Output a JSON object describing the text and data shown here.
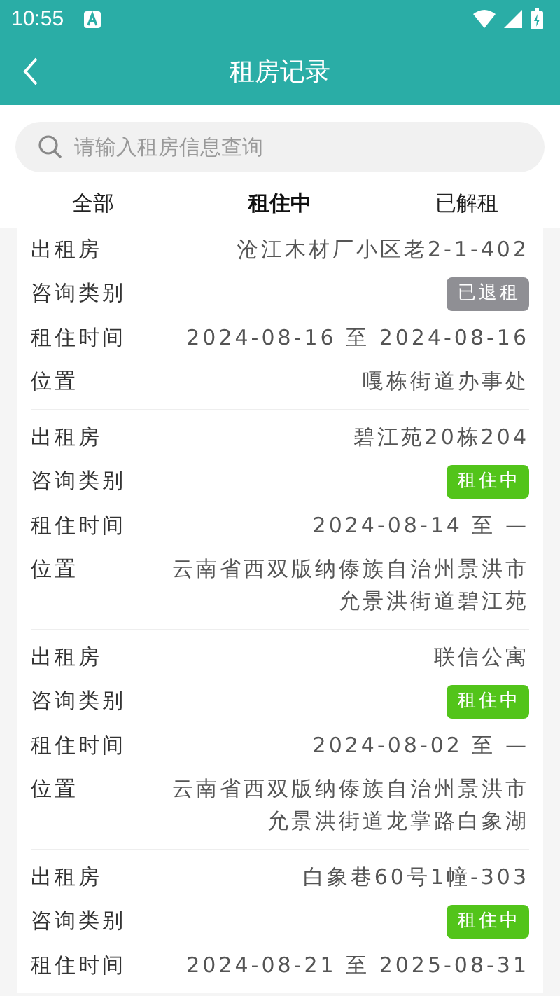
{
  "status_bar": {
    "time": "10:55"
  },
  "header": {
    "title": "租房记录"
  },
  "search": {
    "placeholder": "请输入租房信息查询"
  },
  "tabs": [
    {
      "label": "全部",
      "selected": false
    },
    {
      "label": "租住中",
      "selected": true
    },
    {
      "label": "已解租",
      "selected": false
    }
  ],
  "records": [
    {
      "rows": [
        {
          "kind": "text",
          "label": "出租房",
          "value": "沧江木材厂小区老2-1-402"
        },
        {
          "kind": "badge",
          "label": "咨询类别",
          "badge": {
            "label": "已退租",
            "kind": "ended"
          }
        },
        {
          "kind": "text",
          "label": "租住时间",
          "value": "2024-08-16 至 2024-08-16"
        },
        {
          "kind": "text",
          "label": "位置",
          "value": "嘎栋街道办事处"
        }
      ]
    },
    {
      "rows": [
        {
          "kind": "text",
          "label": "出租房",
          "value": "碧江苑20栋204"
        },
        {
          "kind": "badge",
          "label": "咨询类别",
          "badge": {
            "label": "租住中",
            "kind": "active"
          }
        },
        {
          "kind": "text",
          "label": "租住时间",
          "value": "2024-08-14 至 —"
        },
        {
          "kind": "text",
          "label": "位置",
          "value": "云南省西双版纳傣族自治州景洪市允景洪街道碧江苑"
        }
      ]
    },
    {
      "rows": [
        {
          "kind": "text",
          "label": "出租房",
          "value": "联信公寓"
        },
        {
          "kind": "badge",
          "label": "咨询类别",
          "badge": {
            "label": "租住中",
            "kind": "active"
          }
        },
        {
          "kind": "text",
          "label": "租住时间",
          "value": "2024-08-02 至 —"
        },
        {
          "kind": "text",
          "label": "位置",
          "value": "云南省西双版纳傣族自治州景洪市允景洪街道龙掌路白象湖"
        }
      ]
    },
    {
      "rows": [
        {
          "kind": "text",
          "label": "出租房",
          "value": "白象巷60号1幢-303"
        },
        {
          "kind": "badge",
          "label": "咨询类别",
          "badge": {
            "label": "租住中",
            "kind": "active"
          }
        },
        {
          "kind": "text",
          "label": "租住时间",
          "value": "2024-08-21 至 2025-08-31"
        }
      ]
    }
  ]
}
